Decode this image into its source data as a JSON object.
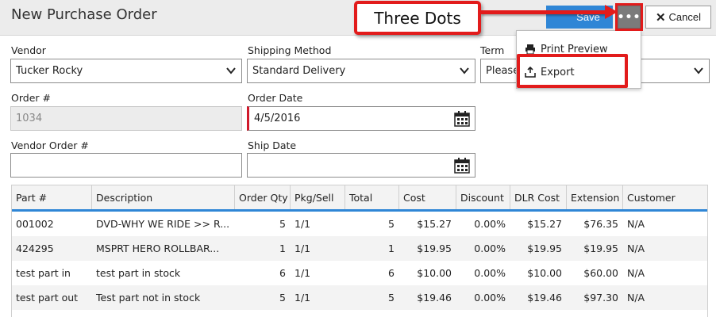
{
  "header": {
    "title": "New Purchase Order",
    "save_label": "Save",
    "dots_label": "•••",
    "cancel_label": "Cancel"
  },
  "callout": {
    "text": "Three Dots"
  },
  "menu": {
    "items": [
      {
        "label": "Print Preview",
        "icon": "printer-icon"
      },
      {
        "label": "Export",
        "icon": "export-icon"
      }
    ]
  },
  "form": {
    "vendor": {
      "label": "Vendor",
      "value": "Tucker Rocky"
    },
    "shipping": {
      "label": "Shipping Method",
      "value": "Standard Delivery"
    },
    "term": {
      "label": "Term",
      "value": "Please"
    },
    "order_no": {
      "label": "Order #",
      "value": "1034"
    },
    "order_date": {
      "label": "Order Date",
      "value": "4/5/2016"
    },
    "vendor_order": {
      "label": "Vendor Order #",
      "value": ""
    },
    "ship_date": {
      "label": "Ship Date",
      "value": ""
    }
  },
  "table": {
    "headers": [
      "Part #",
      "Description",
      "Order Qty",
      "Pkg/Sell",
      "Total",
      "Cost",
      "Discount",
      "DLR Cost",
      "Extension",
      "Customer"
    ],
    "rows": [
      [
        "001002",
        "DVD-WHY WE RIDE >> R...",
        "5",
        "1/1",
        "5",
        "$15.27",
        "0.00%",
        "$15.27",
        "$76.35",
        "N/A"
      ],
      [
        "424295",
        "MSPRT HERO ROLLBAR...",
        "1",
        "1/1",
        "1",
        "$19.95",
        "0.00%",
        "$19.95",
        "$19.95",
        "N/A"
      ],
      [
        "test part in",
        "test part in stock",
        "6",
        "1/1",
        "6",
        "$10.00",
        "0.00%",
        "$10.00",
        "$60.00",
        "N/A"
      ],
      [
        "test part out",
        "Test part not in stock",
        "5",
        "1/1",
        "5",
        "$19.46",
        "0.00%",
        "$19.46",
        "$97.30",
        "N/A"
      ]
    ]
  },
  "colors": {
    "accent": "#2f86d6",
    "annotation": "#e21b1b",
    "required": "#d0192b"
  }
}
